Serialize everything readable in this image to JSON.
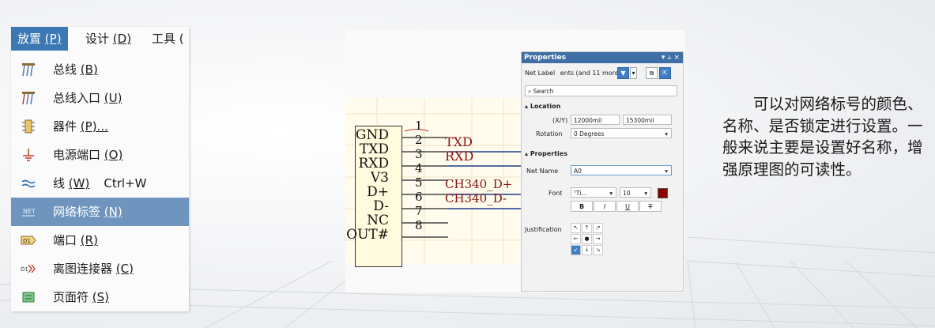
{
  "menubar": {
    "items": [
      {
        "label": "放置",
        "key": "(P)",
        "active": true
      },
      {
        "label": "设计",
        "key": "(D)",
        "active": false
      },
      {
        "label": "工具",
        "key": "(",
        "active": false
      }
    ]
  },
  "menu": {
    "items": [
      {
        "icon": "bus-icon",
        "label": "总线",
        "key": "(B)",
        "shortcut": ""
      },
      {
        "icon": "bus-entry-icon",
        "label": "总线入口",
        "key": "(U)",
        "shortcut": ""
      },
      {
        "icon": "component-icon",
        "label": "器件",
        "key": "(P)...",
        "shortcut": ""
      },
      {
        "icon": "power-port-icon",
        "label": "电源端口",
        "key": "(O)",
        "shortcut": ""
      },
      {
        "icon": "wire-icon",
        "label": "线",
        "key": "(W)",
        "shortcut": "Ctrl+W"
      },
      {
        "icon": "net-label-icon",
        "label": "网络标签",
        "key": "(N)",
        "shortcut": "",
        "highlight": true
      },
      {
        "icon": "port-icon",
        "label": "端口",
        "key": "(R)",
        "shortcut": ""
      },
      {
        "icon": "off-sheet-connector-icon",
        "label": "离图连接器",
        "key": "(C)",
        "shortcut": ""
      },
      {
        "icon": "page-symbol-icon",
        "label": "页面符",
        "key": "(S)",
        "shortcut": ""
      }
    ]
  },
  "schematic": {
    "pins": [
      {
        "name": "GND",
        "num": "1"
      },
      {
        "name": "TXD",
        "num": "2"
      },
      {
        "name": "RXD",
        "num": "3"
      },
      {
        "name": "V3",
        "num": "4"
      },
      {
        "name": "D+",
        "num": "5"
      },
      {
        "name": "D-",
        "num": "6"
      },
      {
        "name": "NC",
        "num": "7"
      },
      {
        "name": "OUT#",
        "num": "8"
      }
    ],
    "nets": [
      "TXD",
      "RXD",
      "CH340_D+",
      "CH340_D-"
    ]
  },
  "properties": {
    "title": "Properties",
    "title_controls": "▾ ⫝ ×",
    "filter_label": "Net Label",
    "filter_text": "ents (and 11 more)",
    "search_placeholder": "Search",
    "location_header": "Location",
    "xy_label": "(X/Y)",
    "x_value": "12000mil",
    "y_value": "15300mil",
    "rotation_label": "Rotation",
    "rotation_value": "0 Degrees",
    "properties_header": "Properties",
    "net_name_label": "Net Name",
    "net_name_value": "A0",
    "font_label": "Font",
    "font_value": "Ti...",
    "font_size": "10",
    "font_color": "#8b0000",
    "bold_label": "B",
    "italic_label": "I",
    "underline_label": "U",
    "strike_label": "T",
    "justification_label": "Justification",
    "justification_glyphs": [
      "↖",
      "↑",
      "↗",
      "←",
      "●",
      "→",
      "↙",
      "↓",
      "↘"
    ]
  },
  "description": {
    "text": "可以对网络标号的颜色、名称、是否锁定进行设置。一般来说主要是设置好名称，增强原理图的可读性。"
  },
  "colors": {
    "menu_active": "#3c78b4",
    "menu_highlight": "#6f95bf",
    "net_label": "#8a1010",
    "panel_title": "#3f6fa6"
  }
}
